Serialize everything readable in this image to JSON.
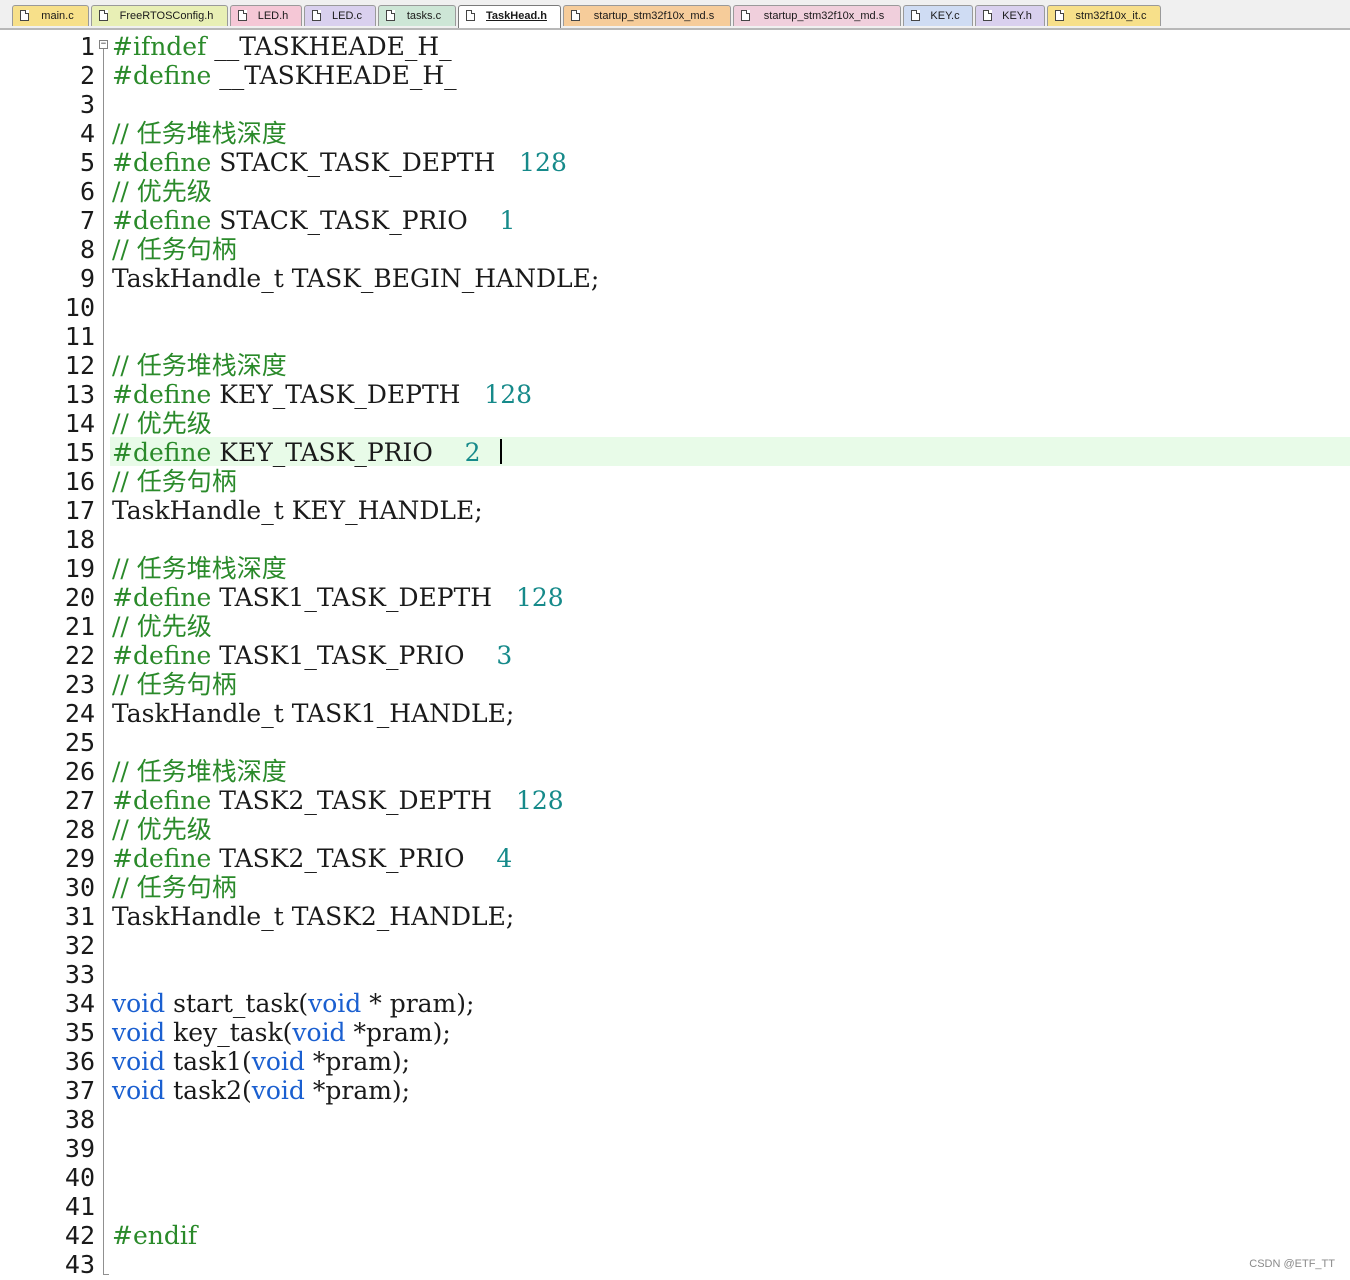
{
  "tabs": [
    {
      "label": "main.c",
      "bg": "#f7e08a",
      "active": false
    },
    {
      "label": "FreeRTOSConfig.h",
      "bg": "#e8efb5",
      "active": false
    },
    {
      "label": "LED.h",
      "bg": "#f5c7d6",
      "active": false
    },
    {
      "label": "LED.c",
      "bg": "#d9d0ee",
      "active": false
    },
    {
      "label": "tasks.c",
      "bg": "#cde6d6",
      "active": false
    },
    {
      "label": "TaskHead.h",
      "bg": "#ffffff",
      "active": true
    },
    {
      "label": "startup_stm32f10x_md.s",
      "bg": "#f6cc9a",
      "active": false
    },
    {
      "label": "startup_stm32f10x_md.s",
      "bg": "#f0cfdc",
      "active": false
    },
    {
      "label": "KEY.c",
      "bg": "#cfdcf3",
      "active": false
    },
    {
      "label": "KEY.h",
      "bg": "#d9d0ee",
      "active": false
    },
    {
      "label": "stm32f10x_it.c",
      "bg": "#f7e08a",
      "active": false
    }
  ],
  "editor": {
    "fold_marker": "−",
    "current_line": 15,
    "lines": [
      [
        [
          "pp",
          "#ifndef "
        ],
        [
          "pl",
          "__TASKHEADE_H_"
        ]
      ],
      [
        [
          "pp",
          "#define "
        ],
        [
          "pl",
          "__TASKHEADE_H_"
        ]
      ],
      [],
      [
        [
          "cm",
          "// 任务堆栈深度"
        ]
      ],
      [
        [
          "pp",
          "#define "
        ],
        [
          "pl",
          "STACK_TASK_DEPTH   "
        ],
        [
          "nm",
          "128"
        ]
      ],
      [
        [
          "cm",
          "// 优先级"
        ]
      ],
      [
        [
          "pp",
          "#define "
        ],
        [
          "pl",
          "STACK_TASK_PRIO    "
        ],
        [
          "nm",
          "1"
        ]
      ],
      [
        [
          "cm",
          "// 任务句柄"
        ]
      ],
      [
        [
          "pl",
          "TaskHandle_t TASK_BEGIN_HANDLE;"
        ]
      ],
      [],
      [],
      [
        [
          "cm",
          "// 任务堆栈深度"
        ]
      ],
      [
        [
          "pp",
          "#define "
        ],
        [
          "pl",
          "KEY_TASK_DEPTH   "
        ],
        [
          "nm",
          "128"
        ]
      ],
      [
        [
          "cm",
          "// 优先级"
        ]
      ],
      [
        [
          "pp",
          "#define "
        ],
        [
          "pl",
          "KEY_TASK_PRIO    "
        ],
        [
          "nm",
          "2"
        ]
      ],
      [
        [
          "cm",
          "// 任务句柄"
        ]
      ],
      [
        [
          "pl",
          "TaskHandle_t KEY_HANDLE;"
        ]
      ],
      [],
      [
        [
          "cm",
          "// 任务堆栈深度"
        ]
      ],
      [
        [
          "pp",
          "#define "
        ],
        [
          "pl",
          "TASK1_TASK_DEPTH   "
        ],
        [
          "nm",
          "128"
        ]
      ],
      [
        [
          "cm",
          "// 优先级"
        ]
      ],
      [
        [
          "pp",
          "#define "
        ],
        [
          "pl",
          "TASK1_TASK_PRIO    "
        ],
        [
          "nm",
          "3"
        ]
      ],
      [
        [
          "cm",
          "// 任务句柄"
        ]
      ],
      [
        [
          "pl",
          "TaskHandle_t TASK1_HANDLE;"
        ]
      ],
      [],
      [
        [
          "cm",
          "// 任务堆栈深度"
        ]
      ],
      [
        [
          "pp",
          "#define "
        ],
        [
          "pl",
          "TASK2_TASK_DEPTH   "
        ],
        [
          "nm",
          "128"
        ]
      ],
      [
        [
          "cm",
          "// 优先级"
        ]
      ],
      [
        [
          "pp",
          "#define "
        ],
        [
          "pl",
          "TASK2_TASK_PRIO    "
        ],
        [
          "nm",
          "4"
        ]
      ],
      [
        [
          "cm",
          "// 任务句柄"
        ]
      ],
      [
        [
          "pl",
          "TaskHandle_t TASK2_HANDLE;"
        ]
      ],
      [],
      [],
      [
        [
          "kw",
          "void"
        ],
        [
          "pl",
          " start_task("
        ],
        [
          "kw",
          "void"
        ],
        [
          "pl",
          " * pram);"
        ]
      ],
      [
        [
          "kw",
          "void"
        ],
        [
          "pl",
          " key_task("
        ],
        [
          "kw",
          "void"
        ],
        [
          "pl",
          " *pram);"
        ]
      ],
      [
        [
          "kw",
          "void"
        ],
        [
          "pl",
          " task1("
        ],
        [
          "kw",
          "void"
        ],
        [
          "pl",
          " *pram);"
        ]
      ],
      [
        [
          "kw",
          "void"
        ],
        [
          "pl",
          " task2("
        ],
        [
          "kw",
          "void"
        ],
        [
          "pl",
          " *pram);"
        ]
      ],
      [],
      [],
      [],
      [],
      [
        [
          "pp",
          "#endif"
        ]
      ],
      []
    ]
  },
  "watermark": "CSDN @ETF_TT"
}
